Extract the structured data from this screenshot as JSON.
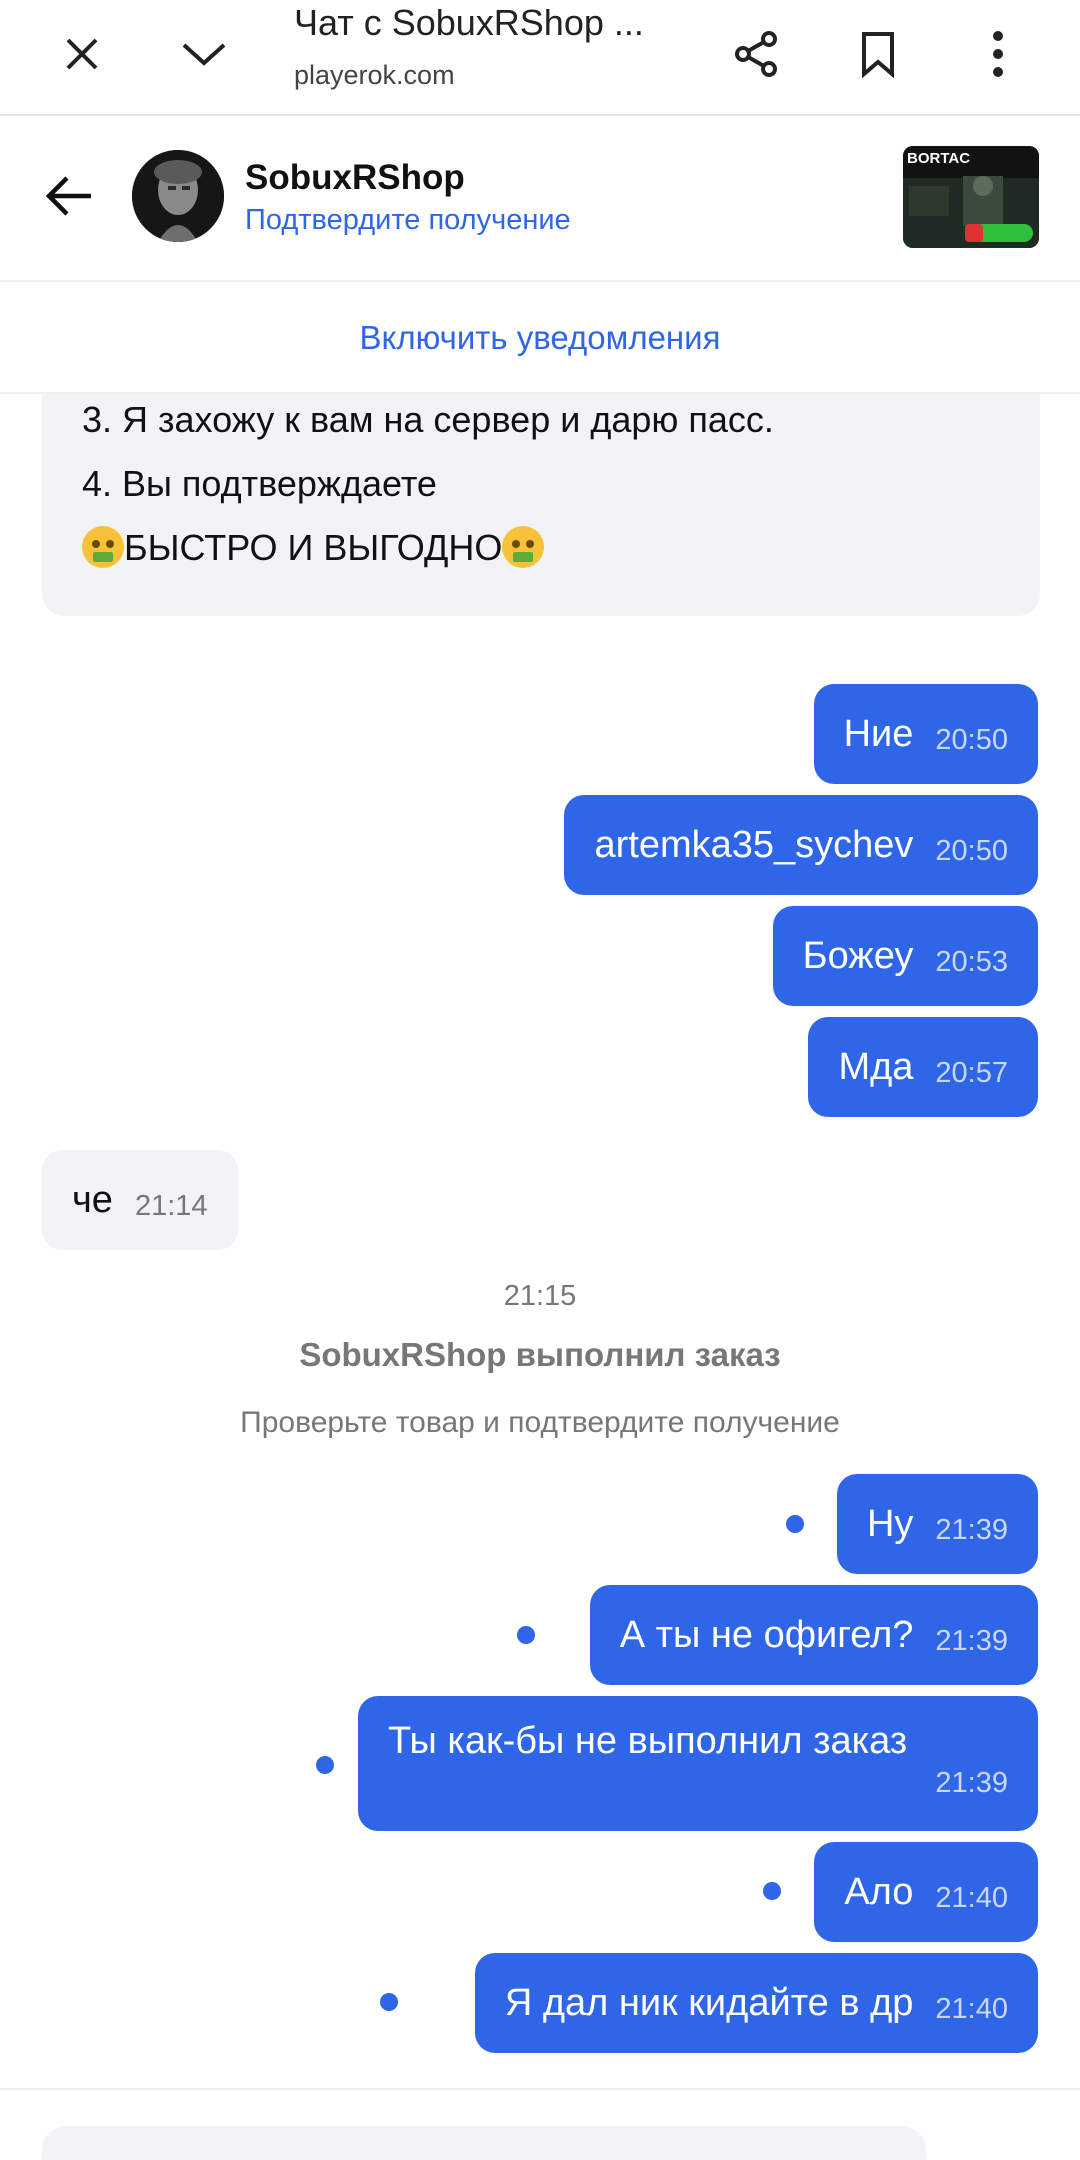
{
  "browser": {
    "title": "Чат с SobuxRShop ...",
    "url": "playerok.com",
    "icons": [
      "close-icon",
      "chevron-down-icon",
      "share-icon",
      "bookmark-icon",
      "more-vertical-icon"
    ]
  },
  "header": {
    "seller_name": "SobuxRShop",
    "seller_status": "Подтвердите получение",
    "product_thumb_text": "BORTAC"
  },
  "notifications": {
    "label": "Включить уведомления"
  },
  "seller_card": {
    "line3": "3. Я захожу к вам на сервер и дарю пасс.",
    "line4": "4. Вы подтверждаете",
    "line5": "БЫСТРО И ВЫГОДНО"
  },
  "messages": [
    {
      "text": "Ние",
      "time": "20:50"
    },
    {
      "text": "artemka35_sychev",
      "time": "20:50"
    },
    {
      "text": "Божеу",
      "time": "20:53"
    },
    {
      "text": "Мда",
      "time": "20:57"
    },
    {
      "text": "че",
      "time": "21:14"
    },
    {
      "text": "Ну",
      "time": "21:39"
    },
    {
      "text": "А ты не офигел?",
      "time": "21:39"
    },
    {
      "text": "Ты как-бы не выполнил заказ",
      "time": "21:39"
    },
    {
      "text": "Ало",
      "time": "21:40"
    },
    {
      "text": "Я дал ник кидайте в др",
      "time": "21:40"
    }
  ],
  "system": {
    "time": "21:15",
    "title": "SobuxRShop выполнил заказ",
    "subtitle": "Проверьте товар и подтвердите получение"
  },
  "colors": {
    "accent": "#2f66e8",
    "incoming_bg": "#f2f3f7"
  }
}
